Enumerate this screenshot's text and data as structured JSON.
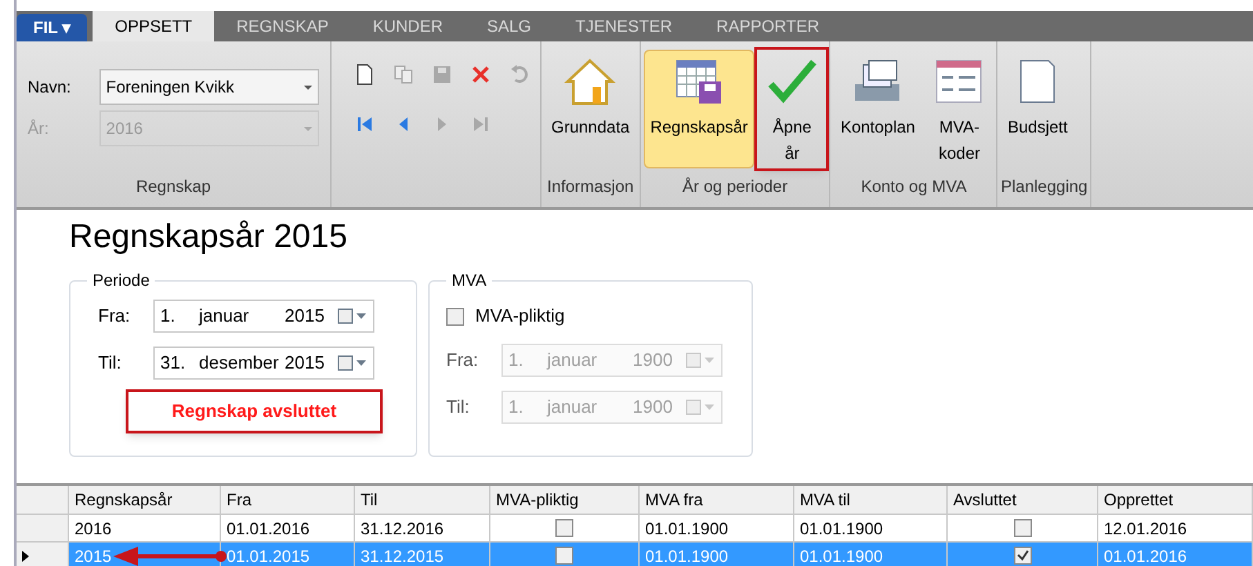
{
  "file_menu": {
    "label": "FIL ▾"
  },
  "tabs": [
    {
      "label": "OPPSETT",
      "selected": true
    },
    {
      "label": "REGNSKAP",
      "selected": false
    },
    {
      "label": "KUNDER",
      "selected": false
    },
    {
      "label": "SALG",
      "selected": false
    },
    {
      "label": "TJENESTER",
      "selected": false
    },
    {
      "label": "RAPPORTER",
      "selected": false
    }
  ],
  "regnskap_group": {
    "label": "Regnskap",
    "name_label": "Navn:",
    "name_value": "Foreningen Kvikk",
    "year_label": "År:",
    "year_value": "2016",
    "year_disabled": true
  },
  "toolbar": {
    "edit_tools": [
      {
        "kind": "new",
        "disabled": false
      },
      {
        "kind": "copy",
        "disabled": true
      },
      {
        "kind": "save",
        "disabled": true
      },
      {
        "kind": "delete",
        "disabled": false
      },
      {
        "kind": "undo",
        "disabled": true
      }
    ],
    "nav_tools": [
      {
        "kind": "first",
        "disabled": false
      },
      {
        "kind": "prev",
        "disabled": false
      },
      {
        "kind": "next",
        "disabled": true
      },
      {
        "kind": "last",
        "disabled": true
      }
    ]
  },
  "ribbon_groups": [
    {
      "label": "Informasjon",
      "buttons": [
        {
          "kind": "house",
          "lines": [
            "Grunndata"
          ],
          "selected": false,
          "highlighted": false
        }
      ]
    },
    {
      "label": "År og perioder",
      "buttons": [
        {
          "kind": "calendar",
          "lines": [
            "Regnskapsår"
          ],
          "selected": true,
          "highlighted": false
        },
        {
          "kind": "check",
          "lines": [
            "Åpne",
            "år"
          ],
          "selected": false,
          "highlighted": true
        }
      ]
    },
    {
      "label": "Konto og MVA",
      "buttons": [
        {
          "kind": "cardfile",
          "lines": [
            "Kontoplan"
          ],
          "selected": false,
          "highlighted": false
        },
        {
          "kind": "form",
          "lines": [
            "MVA-",
            "koder"
          ],
          "selected": false,
          "highlighted": false
        }
      ]
    },
    {
      "label": "Planlegging",
      "buttons": [
        {
          "kind": "page",
          "lines": [
            "Budsjett"
          ],
          "selected": false,
          "highlighted": false
        }
      ]
    }
  ],
  "heading": "Regnskapsår 2015",
  "periode": {
    "legend": "Periode",
    "fields": [
      {
        "label": "Fra:",
        "day": "1.",
        "month": "januar",
        "year": "2015",
        "disabled": false
      },
      {
        "label": "Til:",
        "day": "31.",
        "month": "desember",
        "year": "2015",
        "disabled": false
      }
    ],
    "status": "Regnskap avsluttet"
  },
  "mva": {
    "legend": "MVA",
    "checkbox": {
      "label": "MVA-pliktig",
      "checked": false
    },
    "fields": [
      {
        "label": "Fra:",
        "day": "1.",
        "month": "januar",
        "year": "1900",
        "disabled": true
      },
      {
        "label": "Til:",
        "day": "1.",
        "month": "januar",
        "year": "1900",
        "disabled": true
      }
    ]
  },
  "table": {
    "columns": [
      "Regnskapsår",
      "Fra",
      "Til",
      "MVA-pliktig",
      "MVA fra",
      "MVA til",
      "Avsluttet",
      "Opprettet"
    ],
    "rows": [
      {
        "selected": false,
        "cells": [
          "2016",
          "01.01.2016",
          "31.12.2016",
          false,
          "01.01.1900",
          "01.01.1900",
          false,
          "12.01.2016"
        ]
      },
      {
        "selected": true,
        "cells": [
          "2015",
          "01.01.2015",
          "31.12.2015",
          false,
          "01.01.1900",
          "01.01.1900",
          true,
          "01.01.2016"
        ]
      }
    ]
  }
}
